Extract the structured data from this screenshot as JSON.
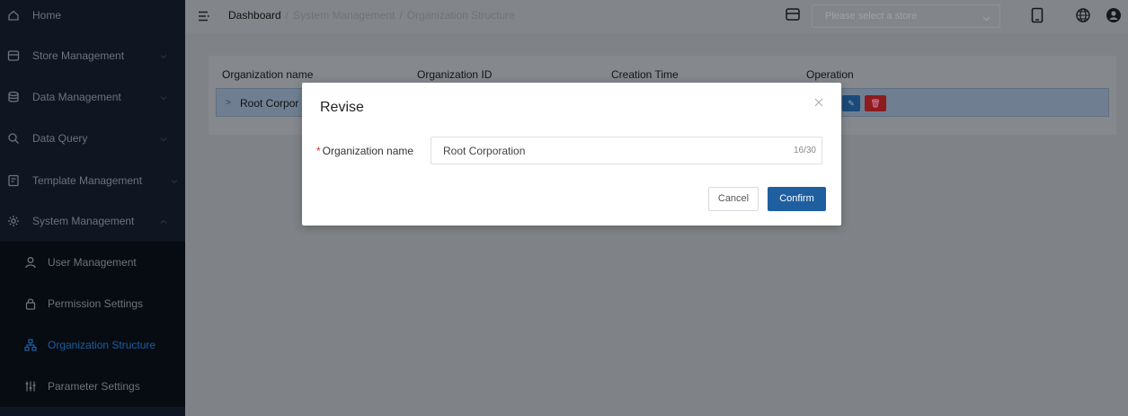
{
  "sidebar": {
    "items": [
      {
        "label": "Home"
      },
      {
        "label": "Store Management"
      },
      {
        "label": "Data Management"
      },
      {
        "label": "Data Query"
      },
      {
        "label": "Template Management"
      },
      {
        "label": "System Management"
      }
    ],
    "sub_items": [
      {
        "label": "User Management"
      },
      {
        "label": "Permission Settings"
      },
      {
        "label": "Organization Structure",
        "active": true
      },
      {
        "label": "Parameter Settings"
      }
    ]
  },
  "header": {
    "breadcrumb": [
      "Dashboard",
      "System Management",
      "Organization Structure"
    ],
    "breadcrumb_sep": "/",
    "store_select": {
      "placeholder": "Please select a store"
    }
  },
  "table": {
    "columns": [
      "Organization name",
      "Organization ID",
      "Creation Time",
      "Operation"
    ],
    "rows": [
      {
        "name": "Root Corpor"
      }
    ]
  },
  "modal": {
    "title": "Revise",
    "field_label": "Organization name",
    "required_mark": "*",
    "field_value": "Root Corporation",
    "field_count": "16/30",
    "cancel_label": "Cancel",
    "confirm_label": "Confirm"
  },
  "colors": {
    "sidebar_bg": "#0f1621",
    "accent": "#1f5fa0",
    "danger": "#8e1b1e",
    "overlay": "#7f8286"
  }
}
